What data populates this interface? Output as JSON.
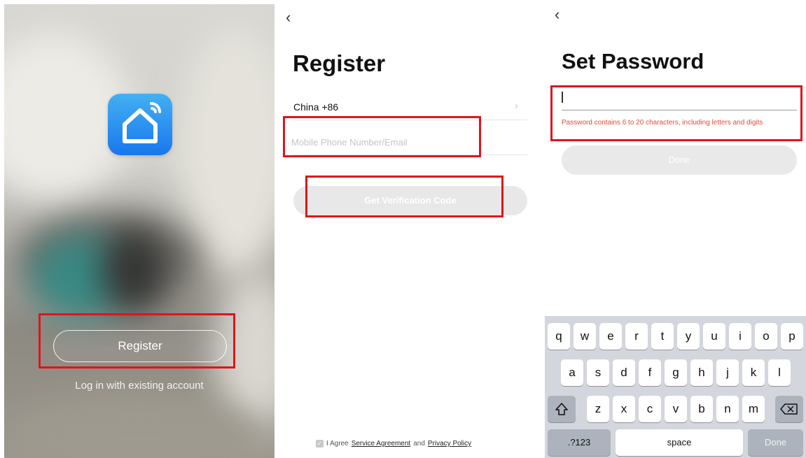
{
  "welcome": {
    "register_label": "Register",
    "login_label": "Log in with existing account",
    "logo_icon": "smart-home-icon",
    "logo_color": "#2a8cf0"
  },
  "register_screen": {
    "back_icon": "chevron-left-icon",
    "title": "Register",
    "country_code": "China +86",
    "phone_placeholder": "Mobile Phone Number/Email",
    "verify_label": "Get Verification Code",
    "agree_prefix": "I Agree",
    "service_link": "Service Agreement",
    "agree_and": "and",
    "privacy_link": "Privacy Policy"
  },
  "password_screen": {
    "back_icon": "chevron-left-icon",
    "title": "Set Password",
    "password_value": "",
    "hint": "Password contains 6 to 20 characters, including letters and digits",
    "done_label": "Done"
  },
  "keyboard": {
    "row1": [
      "q",
      "w",
      "e",
      "r",
      "t",
      "y",
      "u",
      "i",
      "o",
      "p"
    ],
    "row2": [
      "a",
      "s",
      "d",
      "f",
      "g",
      "h",
      "j",
      "k",
      "l"
    ],
    "row3": [
      "z",
      "x",
      "c",
      "v",
      "b",
      "n",
      "m"
    ],
    "numbers_label": ".?123",
    "space_label": "space",
    "done_label": "Done",
    "shift_icon": "shift-icon",
    "delete_icon": "backspace-icon"
  },
  "highlight_color": "#e0141b"
}
